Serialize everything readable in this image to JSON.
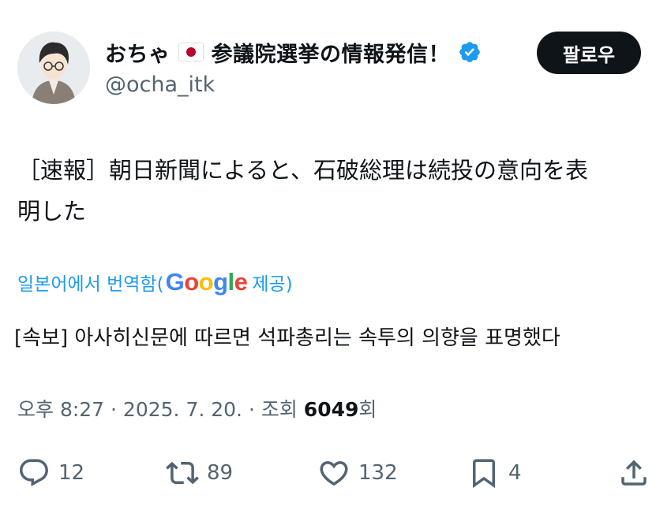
{
  "user": {
    "display_name": "おちゃ 🇯🇵 参議院選挙の情報発信！",
    "name_prefix": "おちゃ",
    "name_suffix": "参議院選挙の情報発信！",
    "handle": "@ocha_itk",
    "avatar_icon": "user-avatar-illustration",
    "flag_icon": "japan-flag-icon",
    "verified_icon": "verified-badge-icon",
    "verified_color": "#1d9bf0"
  },
  "follow_button": {
    "label": "팔로우"
  },
  "tweet": {
    "text_line1": "［速報］朝日新聞によると、石破総理は続投の意向を表",
    "text_line2": "明した"
  },
  "translation": {
    "prefix": "일본어에서 번역함(",
    "google": "Google",
    "suffix": " 제공)",
    "text": "[속보] 아사히신문에 따르면 석파총리는 속투의 의향을 표명했다"
  },
  "meta": {
    "time": "오후 8:27 · 2025. 7. 20. · 조회 ",
    "views": "6049",
    "views_suffix": "회"
  },
  "actions": {
    "reply_count": "12",
    "retweet_count": "89",
    "like_count": "132",
    "bookmark_count": "4"
  },
  "colors": {
    "text": "#0f1419",
    "secondary": "#536471",
    "accent": "#1d9bf0"
  }
}
